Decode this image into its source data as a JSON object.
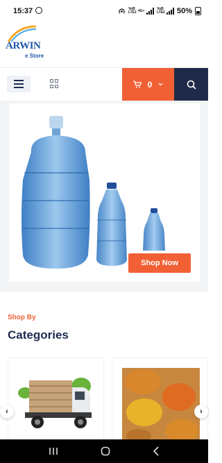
{
  "status": {
    "time": "15:37",
    "battery": "50%",
    "net1": "VoB LTE1",
    "net2": "4G+",
    "net3": "VoB LTE2"
  },
  "logo": {
    "brand": "ARWIN",
    "sub": "e Store"
  },
  "header": {
    "cart_count": "0"
  },
  "banner": {
    "cta": "Shop Now"
  },
  "section": {
    "kicker": "Shop By",
    "title": "Categories"
  },
  "categories": [
    {
      "name": "delivery-truck"
    },
    {
      "name": "spices"
    }
  ],
  "colors": {
    "accent": "#f16035",
    "navy": "#1f2a4a"
  }
}
